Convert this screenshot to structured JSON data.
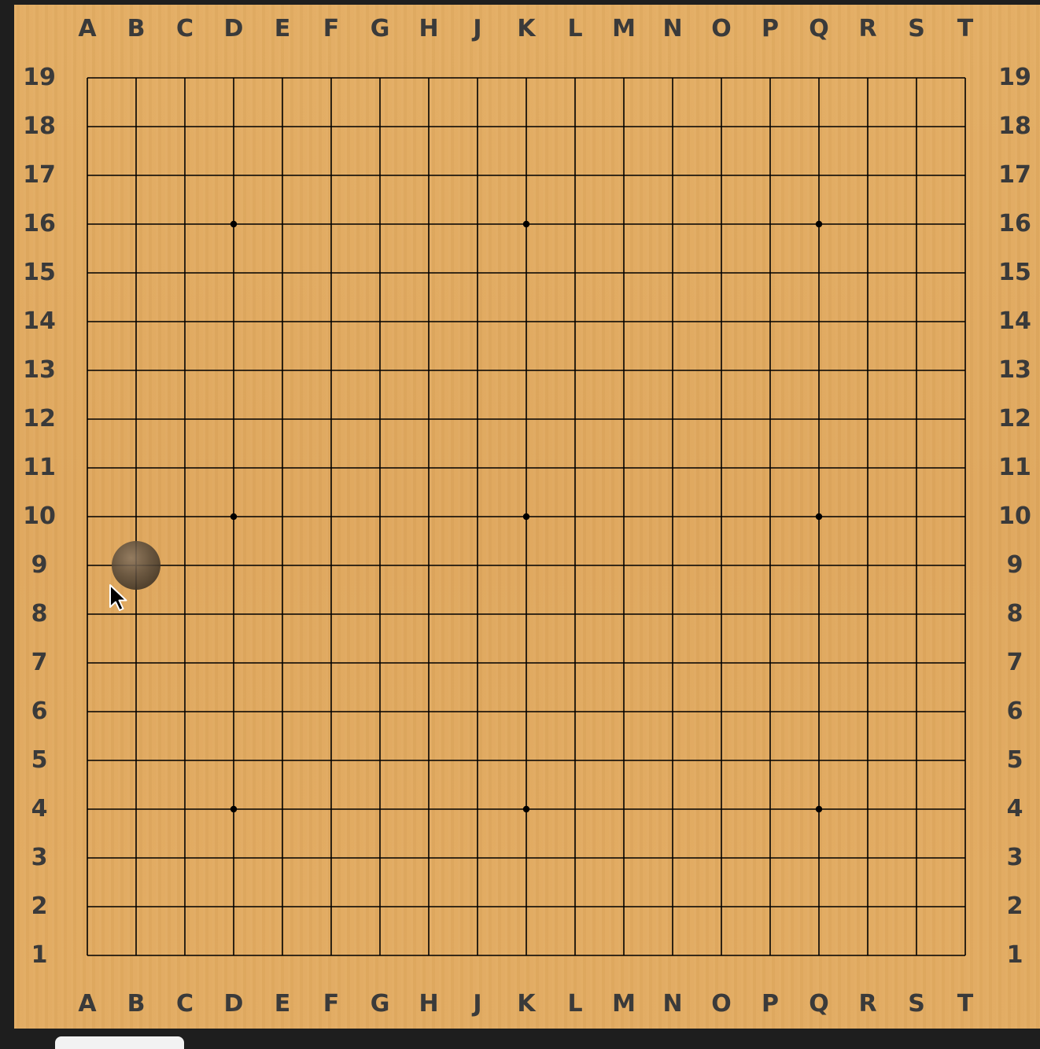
{
  "board": {
    "size": 19,
    "colors": {
      "wood": "#e0a95f",
      "line": "#000000",
      "label": "#3a3a3a",
      "background": "#1e1e1e"
    },
    "columns": [
      "A",
      "B",
      "C",
      "D",
      "E",
      "F",
      "G",
      "H",
      "J",
      "K",
      "L",
      "M",
      "N",
      "O",
      "P",
      "Q",
      "R",
      "S",
      "T"
    ],
    "rows": [
      "19",
      "18",
      "17",
      "16",
      "15",
      "14",
      "13",
      "12",
      "11",
      "10",
      "9",
      "8",
      "7",
      "6",
      "5",
      "4",
      "3",
      "2",
      "1"
    ],
    "star_points": [
      "D16",
      "K16",
      "Q16",
      "D10",
      "K10",
      "Q10",
      "D4",
      "K4",
      "Q4"
    ],
    "hover_stone": {
      "point": "B9",
      "color": "black",
      "style": "translucent-preview"
    }
  },
  "cursor": {
    "icon": "arrow-pointer-icon"
  }
}
